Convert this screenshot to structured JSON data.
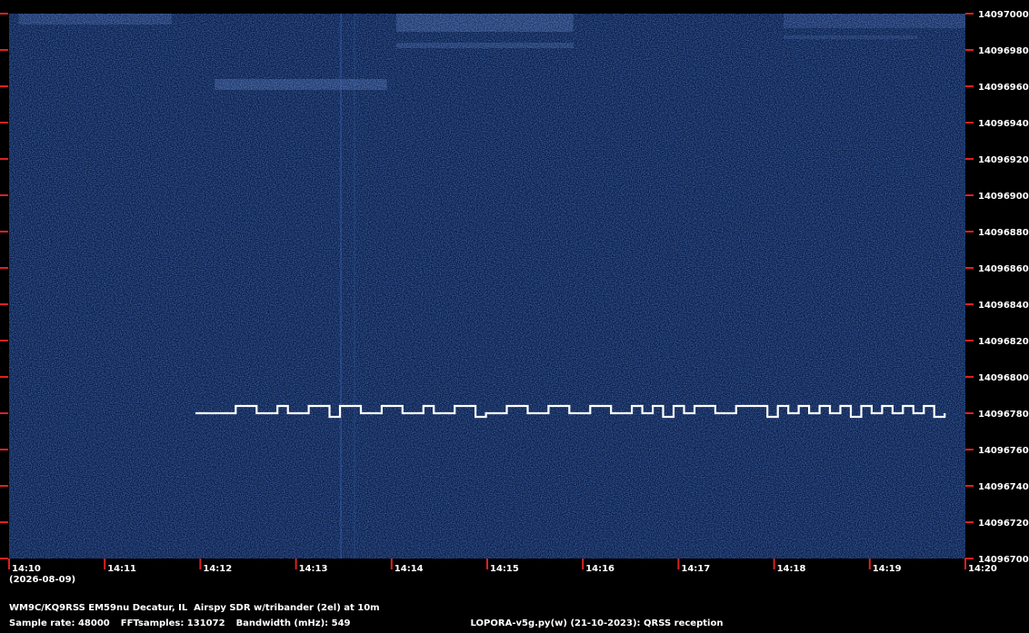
{
  "chart_data": {
    "type": "heatmap",
    "title": "",
    "xlabel": "",
    "ylabel": "",
    "x_ticks": [
      "14:10",
      "14:11",
      "14:12",
      "14:13",
      "14:14",
      "14:15",
      "14:16",
      "14:17",
      "14:18",
      "14:19",
      "14:20"
    ],
    "x_subtitle": "(2026-08-09)",
    "xlim": [
      "14:10",
      "14:20"
    ],
    "y_ticks": [
      14097000,
      14096980,
      14096960,
      14096940,
      14096920,
      14096900,
      14096880,
      14096860,
      14096840,
      14096820,
      14096800,
      14096780,
      14096760,
      14096740,
      14096720,
      14096700
    ],
    "ylim": [
      14096700,
      14097000
    ],
    "signal": {
      "base_freq": 14096780,
      "shift_freq": 14096784,
      "start_time": "14:11:57",
      "end_time": "14:19:47",
      "pattern": [
        0,
        2,
        1,
        1,
        0,
        1,
        1,
        0,
        2,
        3,
        0,
        2,
        1,
        1,
        0,
        2,
        1,
        1,
        0,
        1,
        1,
        0,
        2,
        3,
        1,
        1,
        0,
        2,
        1,
        1,
        0,
        2,
        1,
        1,
        0,
        2,
        1,
        1,
        0,
        1,
        0,
        3,
        0,
        1,
        0,
        2,
        1,
        1,
        0,
        2,
        2,
        3,
        0,
        1,
        0,
        1,
        0,
        1,
        0,
        3,
        0,
        1,
        0,
        1,
        0,
        1,
        0,
        3
      ]
    },
    "colors": {
      "background": "#0a1e4a",
      "signal": "#ffffff",
      "tick": "#e02020"
    }
  },
  "footer": {
    "station": "WM9C/KQ9RSS EM59nu Decatur, IL  Airspy SDR w/tribander (2el) at 10m",
    "sample_rate": "Sample rate: 48000",
    "fft_samples": "FFTsamples: 131072",
    "bandwidth": "Bandwidth (mHz): 549",
    "software": "LOPORA-v5g.py(w) (21-10-2023): QRSS reception"
  }
}
